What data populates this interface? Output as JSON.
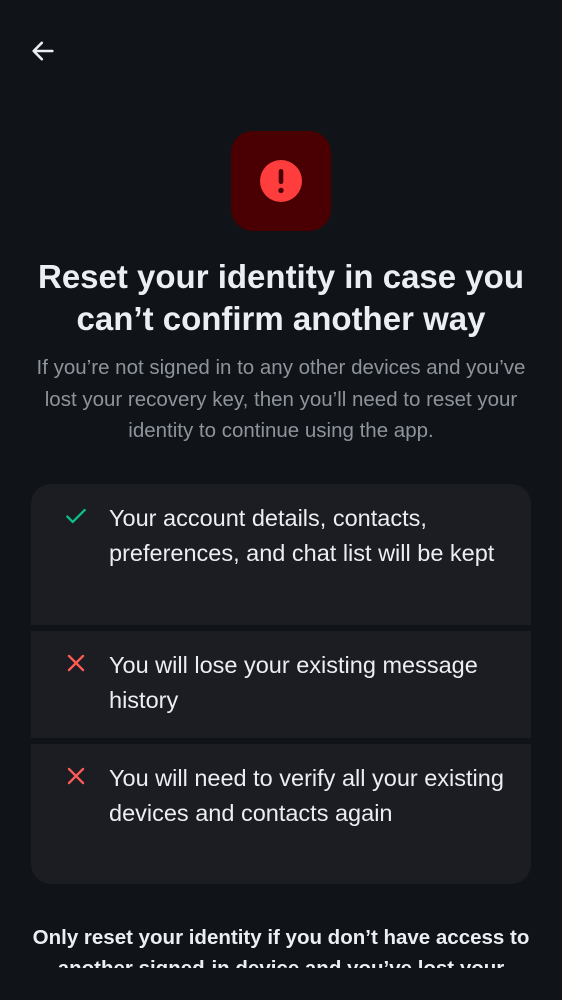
{
  "header": {
    "back_icon": "arrow-left-icon"
  },
  "hero": {
    "icon": "error-circle-icon",
    "icon_bg": "#4a0002",
    "icon_color": "#ff3d3d"
  },
  "title": "Reset your identity in case you can’t confirm another way",
  "subtitle": "If you’re not signed in to any other devices and you’ve lost your recovery key, then you’ll need to reset your identity to continue using the app.",
  "consequences": [
    {
      "icon": "check-icon",
      "color": "#0dbd8b",
      "text": "Your account details, contacts, preferences, and chat list will be kept"
    },
    {
      "icon": "close-icon",
      "color": "#ff5b55",
      "text": "You will lose your existing message history"
    },
    {
      "icon": "close-icon",
      "color": "#ff5b55",
      "text": "You will need to verify all your existing devices and contacts again"
    }
  ],
  "footer": {
    "text": "Only reset your identity if you don’t have access to another signed-in device and you’ve lost your recovery key."
  }
}
